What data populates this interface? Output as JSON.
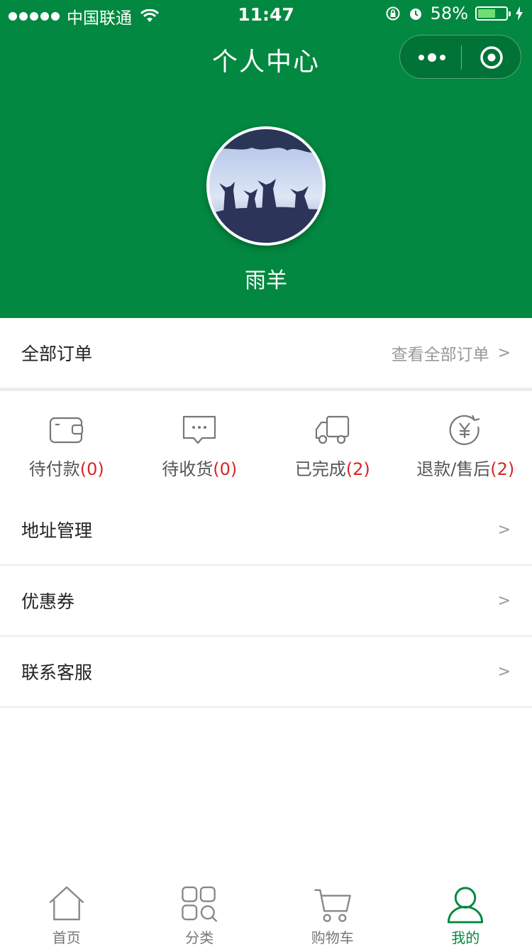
{
  "status_bar": {
    "carrier": "中国联通",
    "time": "11:47",
    "battery": "58%",
    "battery_level": 0.58
  },
  "nav": {
    "title": "个人中心",
    "more_icon": "more-dots-icon",
    "close_icon": "target-close-icon"
  },
  "profile": {
    "username": "雨羊",
    "avatar": "avatar-deer-silhouette"
  },
  "orders": {
    "title": "全部订单",
    "view_all": "查看全部订单",
    "chevron": ">"
  },
  "order_status": [
    {
      "label": "待付款",
      "count": "(0)",
      "icon": "wallet-icon"
    },
    {
      "label": "待收货",
      "count": "(0)",
      "icon": "message-icon"
    },
    {
      "label": "已完成",
      "count": "(2)",
      "icon": "truck-icon"
    },
    {
      "label": "退款/售后",
      "count": "(2)",
      "icon": "refund-yen-icon"
    }
  ],
  "menu": [
    {
      "label": "地址管理",
      "chevron": ">"
    },
    {
      "label": "优惠券",
      "chevron": ">"
    },
    {
      "label": "联系客服",
      "chevron": ">"
    }
  ],
  "tabbar": [
    {
      "label": "首页",
      "icon": "home-icon",
      "active": false
    },
    {
      "label": "分类",
      "icon": "category-icon",
      "active": false
    },
    {
      "label": "购物车",
      "icon": "cart-icon",
      "active": false
    },
    {
      "label": "我的",
      "icon": "user-icon",
      "active": true
    }
  ],
  "colors": {
    "brand_green": "#028840",
    "count_red": "#d42727",
    "muted_text": "#999999"
  }
}
